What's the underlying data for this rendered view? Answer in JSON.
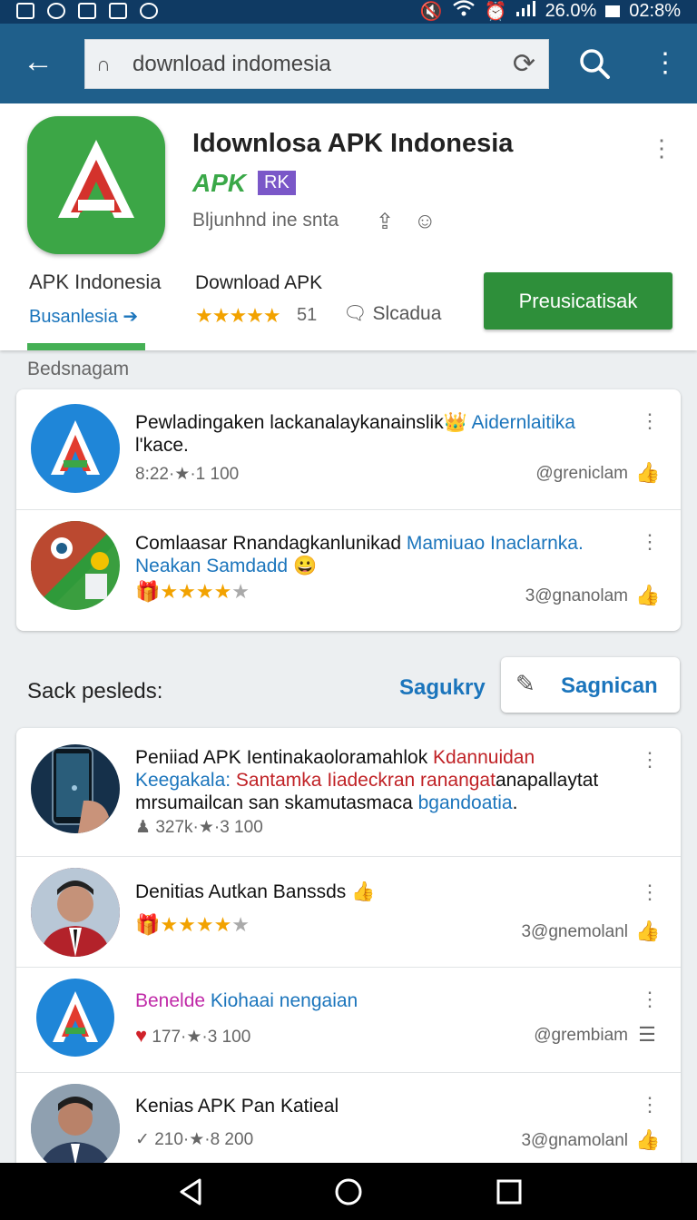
{
  "status_bar": {
    "battery_percent": "26.0%",
    "time": "02:8%"
  },
  "toolbar": {
    "url_text": "download indomesia"
  },
  "app": {
    "title": "Idownlosa APK Indonesia",
    "apk_tag": "APK",
    "badge": "RK",
    "subline": "Bljunhnd ine snta",
    "developer": "APK Indonesia",
    "developer_link": "Busanlesia ➔",
    "download_label": "Download APK",
    "rating_stars": "★★★★★",
    "rating_value": "51",
    "reviews_label": "Slcadua",
    "install_label": "Preusicatisak"
  },
  "section_title": "Bedsnagam",
  "top_list": [
    {
      "title_main": "Pewladingaken lackanalaykanainslik",
      "title_emoji": "👑",
      "title_hl": " Aidernlaitika",
      "title_tail": "l'kace.",
      "meta": "8:22·★·1 100",
      "right": "@greniclam"
    },
    {
      "title_main": "Comlaasar Rnandagkanlunikad",
      "title_hl": " Mamiuao Inaclarnka.",
      "title_line2_hl": "Neakan Samdadd",
      "title_emoji": "😀",
      "stars": "★★★★",
      "star_gray": "★",
      "right": "3@gnanolam"
    }
  ],
  "sort": {
    "label": "Sack pesleds:",
    "link": "Sagukry",
    "button": "Sagnican"
  },
  "bottom_list": [
    {
      "l1a": "Peniiad APK Ientinakaoloramahlok",
      "l1b": " Kdannuidan",
      "l2a": "Keegakala:",
      "l2b": " Santamka Iiadeckran ranangat",
      "l2c": "anapallaytat",
      "l3a": "mrsumailcan san skamutasmaca",
      "l3b": " bgandoatia",
      "l3c": ".",
      "meta": "327k·★·3 100"
    },
    {
      "title": "Denitias Autkan Banssds",
      "emoji": "👍",
      "stars": "★★★★",
      "star_gray": "★",
      "right": "3@gnemolanl"
    },
    {
      "title_a": "Benelde",
      "title_b": " Kiohaai nengaian",
      "meta": "177·★·3 100",
      "right": "@grembiam"
    },
    {
      "title": "Kenias APK Pan Katieal",
      "meta": "210·★·8 200",
      "right": "3@gnamolanl"
    }
  ]
}
